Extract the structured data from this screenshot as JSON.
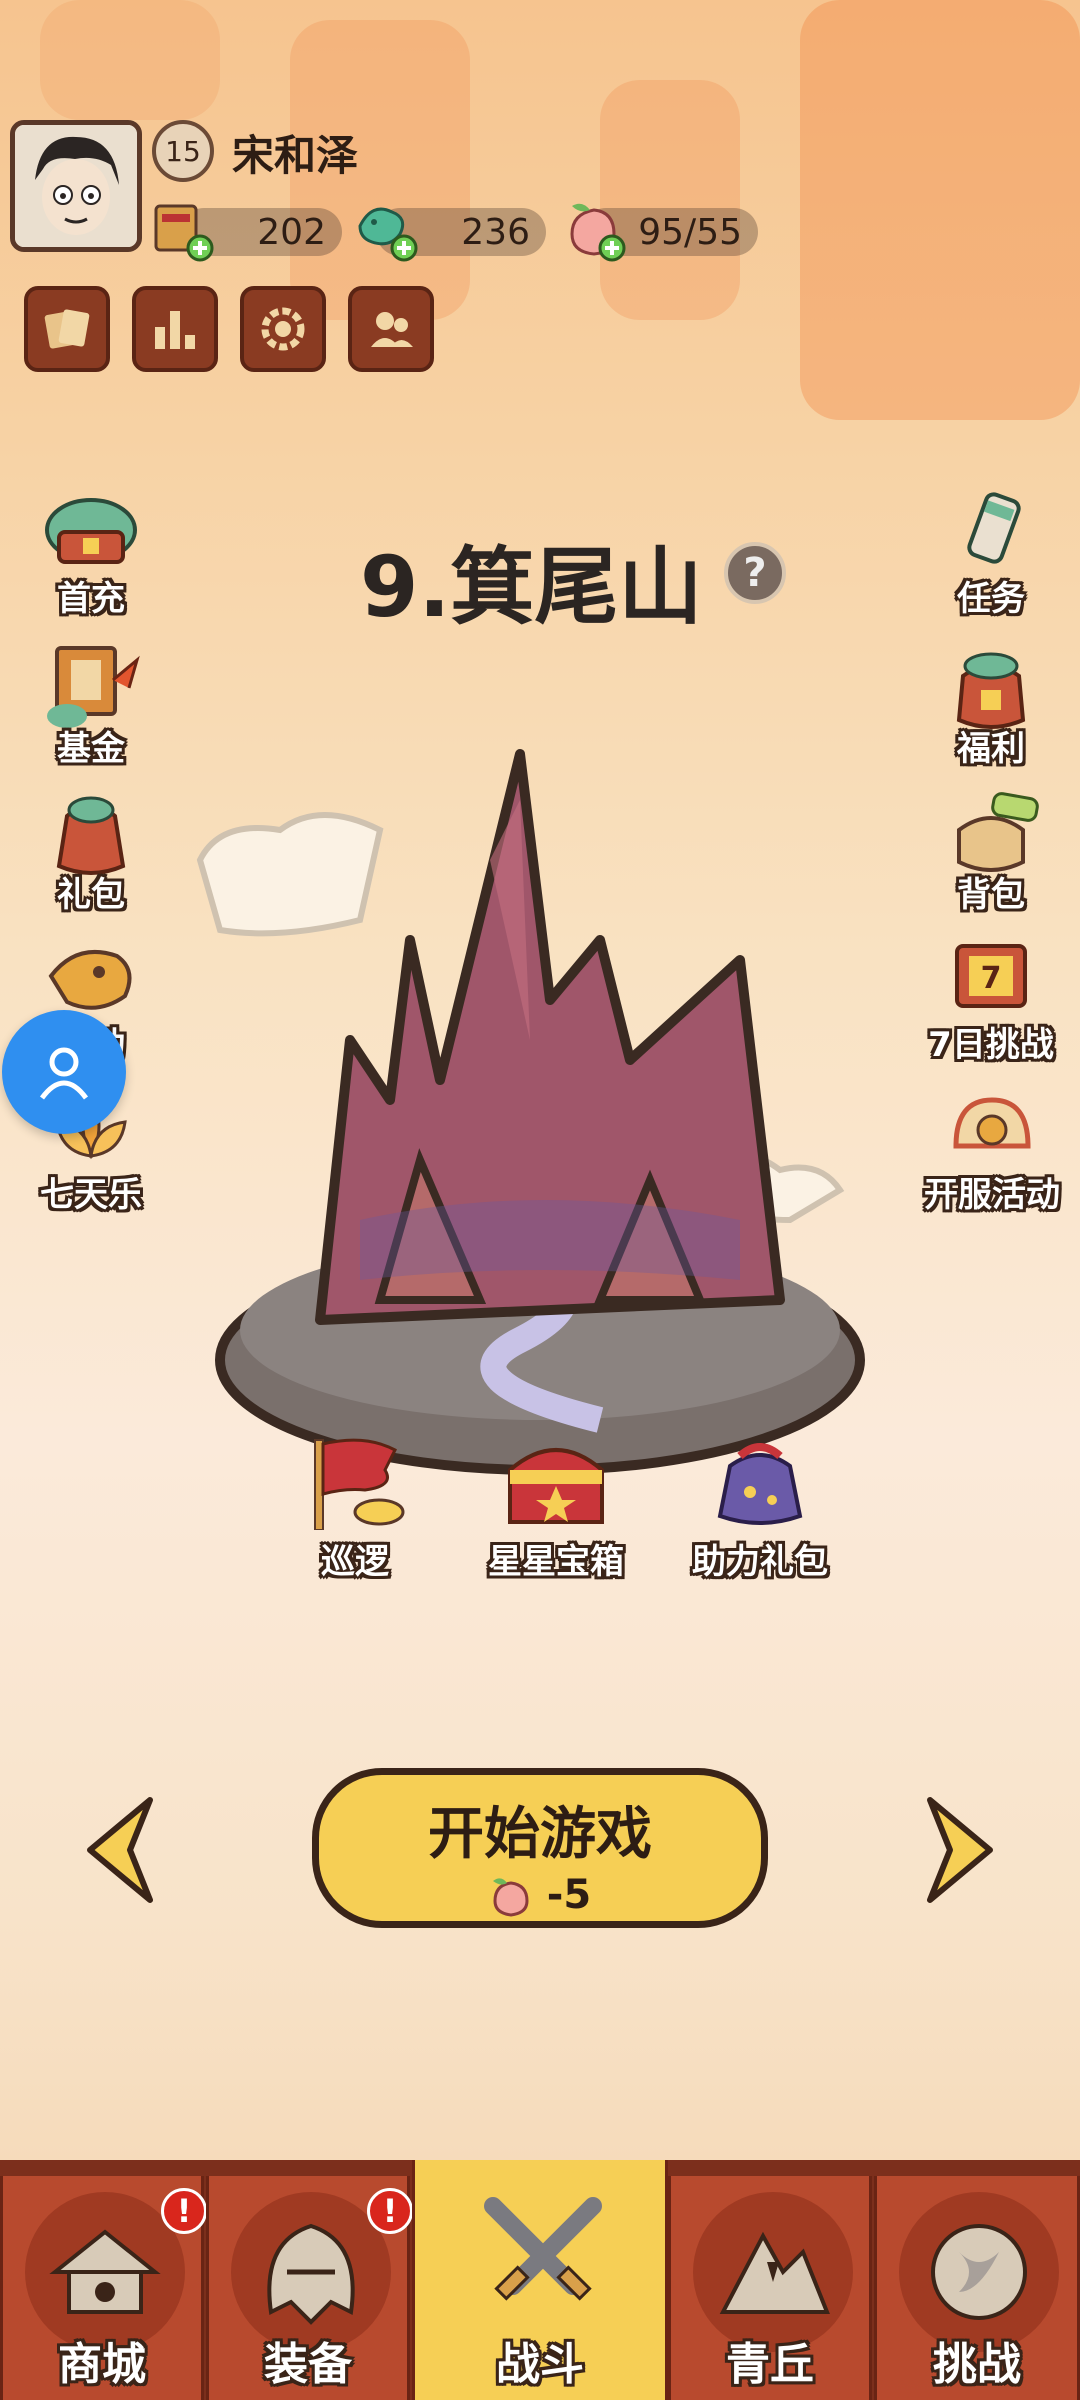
{
  "player": {
    "name": "宋和泽",
    "level": "15"
  },
  "resources": [
    {
      "icon": "ticket-icon",
      "value": "202"
    },
    {
      "icon": "jade-dragon-icon",
      "value": "236"
    },
    {
      "icon": "peach-icon",
      "value": "95/55"
    }
  ],
  "utility_buttons": [
    {
      "icon": "cards-icon"
    },
    {
      "icon": "rank-bars-icon"
    },
    {
      "icon": "settings-gear-icon"
    },
    {
      "icon": "friends-icon"
    }
  ],
  "left_menu": [
    {
      "label": "首充"
    },
    {
      "label": "基金"
    },
    {
      "label": "礼包"
    },
    {
      "label": "活动"
    },
    {
      "label": "七天乐"
    }
  ],
  "right_menu": [
    {
      "label": "任务"
    },
    {
      "label": "福利"
    },
    {
      "label": "背包"
    },
    {
      "label": "7日挑战"
    },
    {
      "label": "开服活动"
    }
  ],
  "stage": {
    "title": "9.箕尾山",
    "help": "?"
  },
  "stage_actions": [
    {
      "label": "巡逻"
    },
    {
      "label": "星星宝箱"
    },
    {
      "label": "助力礼包"
    }
  ],
  "start_button": {
    "label": "开始游戏",
    "cost": "-5"
  },
  "bottom_nav": [
    {
      "label": "商城",
      "badge": "!"
    },
    {
      "label": "装备",
      "badge": "!"
    },
    {
      "label": "战斗",
      "active": true
    },
    {
      "label": "青丘"
    },
    {
      "label": "挑战"
    }
  ],
  "colors": {
    "accent": "#f6cf55",
    "nav": "#b84a2e",
    "float_button": "#2f8ff0"
  }
}
